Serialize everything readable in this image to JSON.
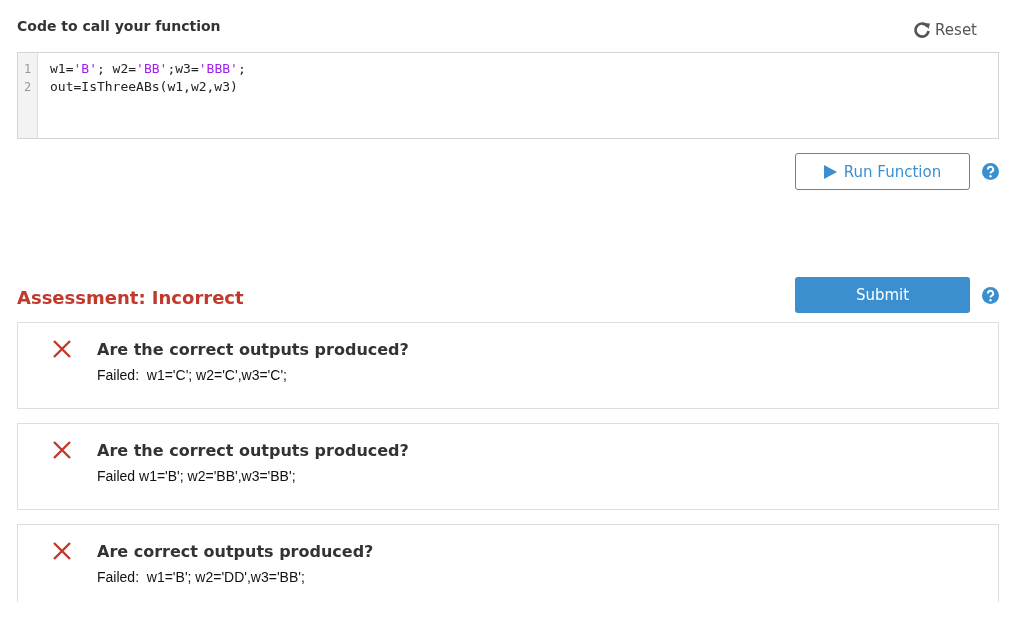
{
  "header": {
    "title": "Code to call your function",
    "reset_label": "Reset"
  },
  "editor": {
    "lines": [
      {
        "number": "1",
        "tokens": [
          {
            "kind": "plain",
            "text": "w1="
          },
          {
            "kind": "string",
            "text": "'B'"
          },
          {
            "kind": "plain",
            "text": "; w2="
          },
          {
            "kind": "string",
            "text": "'BB'"
          },
          {
            "kind": "plain",
            "text": ";w3="
          },
          {
            "kind": "string",
            "text": "'BBB'"
          },
          {
            "kind": "plain",
            "text": ";"
          }
        ]
      },
      {
        "number": "2",
        "tokens": [
          {
            "kind": "plain",
            "text": "out=IsThreeABs(w1,w2,w3)"
          }
        ]
      }
    ]
  },
  "run_button": {
    "label": "Run Function"
  },
  "assessment": {
    "title": "Assessment: Incorrect",
    "submit_label": "Submit"
  },
  "checks": [
    {
      "passed": false,
      "question": "Are the correct outputs produced?",
      "detail": "Failed:  w1='C'; w2='C',w3='C';"
    },
    {
      "passed": false,
      "question": "Are the correct outputs produced?",
      "detail": "Failed w1='B'; w2='BB',w3='BB';"
    },
    {
      "passed": false,
      "question": "Are correct outputs produced?",
      "detail": "Failed:  w1='B'; w2='DD',w3='BB';"
    }
  ]
}
